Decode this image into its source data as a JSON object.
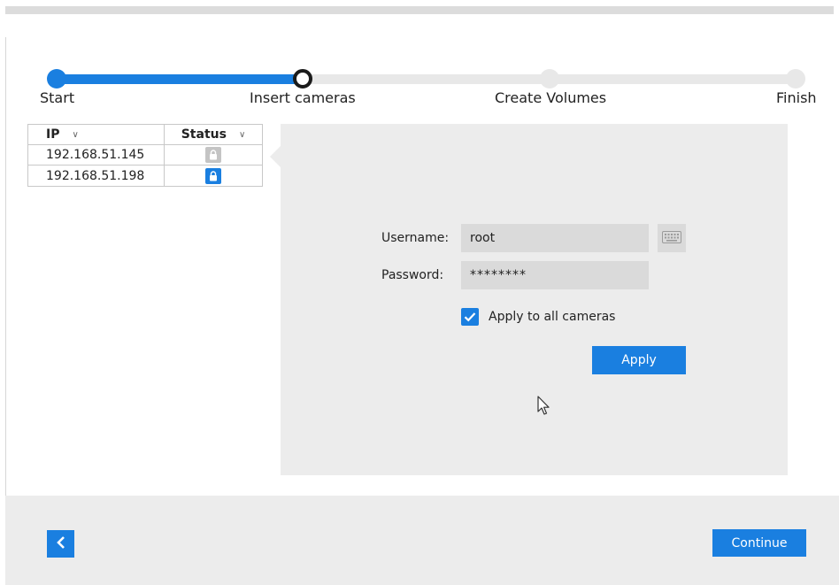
{
  "stepper": {
    "steps": [
      {
        "label": "Start",
        "state": "done"
      },
      {
        "label": "Insert cameras",
        "state": "current"
      },
      {
        "label": "Create Volumes",
        "state": "pending"
      },
      {
        "label": "Finish",
        "state": "pending"
      }
    ]
  },
  "camera_table": {
    "columns": [
      "IP",
      "Status"
    ],
    "rows": [
      {
        "ip": "192.168.51.145",
        "status": "locked-grey"
      },
      {
        "ip": "192.168.51.198",
        "status": "locked-blue"
      }
    ]
  },
  "login_form": {
    "username_label": "Username:",
    "username_value": "root",
    "password_label": "Password:",
    "password_value": "********",
    "apply_all_label": "Apply to all cameras",
    "apply_all_checked": true,
    "apply_button": "Apply"
  },
  "footer": {
    "continue_button": "Continue"
  },
  "colors": {
    "accent": "#1a7fe0",
    "panel": "#ececec"
  }
}
